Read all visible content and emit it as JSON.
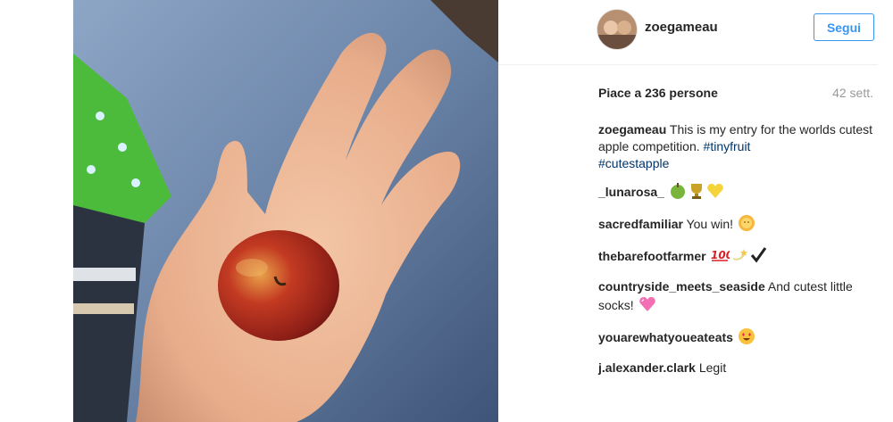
{
  "post": {
    "author": "zoegameau",
    "follow_label": "Segui",
    "likes_text": "Piace a 236 persone",
    "time_text": "42 sett.",
    "caption": {
      "user": "zoegameau",
      "text": "This is my entry for the worlds cutest apple competition.",
      "hashtags": [
        "#tinyfruit",
        "#cutestapple"
      ]
    }
  },
  "comments": [
    {
      "user": "_lunarosa_",
      "text": "",
      "emojis": [
        "green-apple-icon",
        "trophy-icon",
        "yellow-heart-icon"
      ]
    },
    {
      "user": "sacredfamiliar",
      "text": "You win!",
      "emojis": [
        "sun-face-icon"
      ]
    },
    {
      "user": "thebarefootfarmer",
      "text": "",
      "emojis": [
        "hundred-points-icon",
        "dizzy-icon",
        "check-mark-icon"
      ]
    },
    {
      "user": "countryside_meets_seaside",
      "text": "And cutest little socks!",
      "emojis": [
        "pink-heart-icon"
      ]
    },
    {
      "user": "youarewhatyoueateats",
      "text": "",
      "emojis": [
        "heart-eyes-icon"
      ]
    },
    {
      "user": "j.alexander.clark",
      "text": "Legit",
      "emojis": []
    }
  ],
  "colors": {
    "follow_blue": "#3897f0",
    "hashtag": "#003569",
    "muted": "#999999"
  }
}
